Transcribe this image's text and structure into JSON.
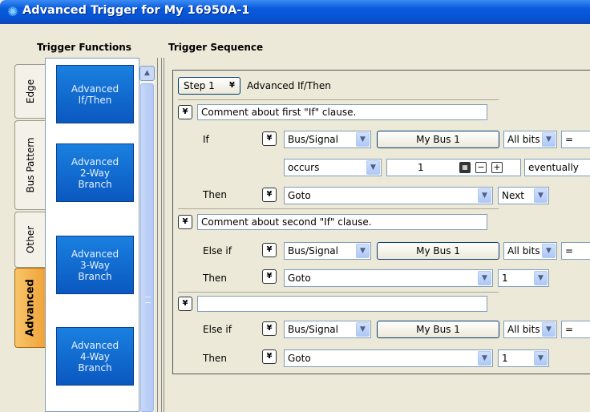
{
  "window": {
    "title": "Advanced Trigger for My 16950A-1"
  },
  "headers": {
    "functions": "Trigger Functions",
    "sequence": "Trigger Sequence"
  },
  "tabs": [
    "Edge",
    "Bus Pattern",
    "Other",
    "Advanced"
  ],
  "functions": [
    {
      "label": "Advanced\nIf/Then"
    },
    {
      "label": "Advanced\n2-Way\nBranch"
    },
    {
      "label": "Advanced\n3-Way\nBranch"
    },
    {
      "label": "Advanced\n4-Way\nBranch"
    }
  ],
  "step": {
    "selector": "Step 1",
    "title": "Advanced If/Then"
  },
  "clause1": {
    "comment": "Comment about first \"If\" clause.",
    "if_label": "If",
    "type": "Bus/Signal",
    "bus": "My Bus 1",
    "bits": "All bits",
    "op": "=",
    "occurs": "occurs",
    "count": "1",
    "when": "eventually",
    "then_label": "Then",
    "action": "Goto",
    "target": "Next"
  },
  "clause2": {
    "comment": "Comment about second \"If\" clause.",
    "if_label": "Else if",
    "type": "Bus/Signal",
    "bus": "My Bus 1",
    "bits": "All bits",
    "op": "=",
    "then_label": "Then",
    "action": "Goto",
    "target": "1"
  },
  "clause3": {
    "comment": "",
    "if_label": "Else if",
    "type": "Bus/Signal",
    "bus": "My Bus 1",
    "bits": "All bits",
    "op": "=",
    "then_label": "Then",
    "action": "Goto",
    "target": "1"
  },
  "icons": {
    "chevron": "chevron-double-down-icon",
    "dropdown": "dropdown-arrow-icon",
    "calculator": "calculator-icon"
  }
}
